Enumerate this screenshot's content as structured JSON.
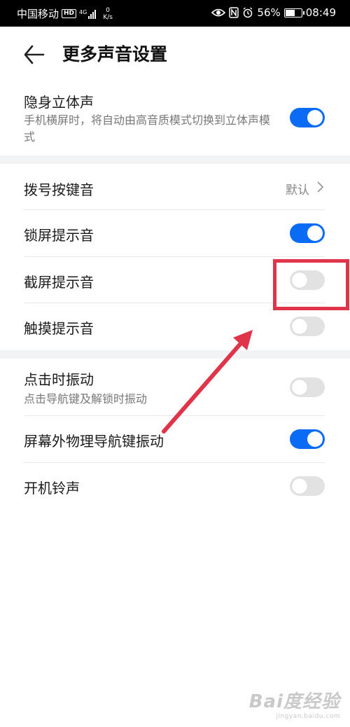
{
  "status_bar": {
    "carrier": "中国移动",
    "hd": "HD",
    "net_type": "4G",
    "speed_value": "0",
    "speed_unit": "K/s",
    "battery": "56%",
    "time": "08:49"
  },
  "header": {
    "title": "更多声音设置"
  },
  "stereo": {
    "label": "隐身立体声",
    "sub": "手机横屏时，将自动由高音质模式切换到立体声模式",
    "on": true
  },
  "dial_tone": {
    "label": "拨号按键音",
    "value": "默认"
  },
  "lock_sound": {
    "label": "锁屏提示音",
    "on": true
  },
  "screenshot_sound": {
    "label": "截屏提示音",
    "on": false
  },
  "touch_sound": {
    "label": "触摸提示音",
    "on": false
  },
  "tap_vibration": {
    "label": "点击时振动",
    "sub": "点击导航键及解锁时振动",
    "on": false
  },
  "nav_vibration": {
    "label": "屏幕外物理导航键振动",
    "on": true
  },
  "boot_ringtone": {
    "label": "开机铃声",
    "on": false
  },
  "watermark": {
    "brand": "Bai度经验",
    "url": "jingyan.baidu.com"
  },
  "colors": {
    "accent": "#0a6cf5",
    "annotation": "#e0344a"
  }
}
